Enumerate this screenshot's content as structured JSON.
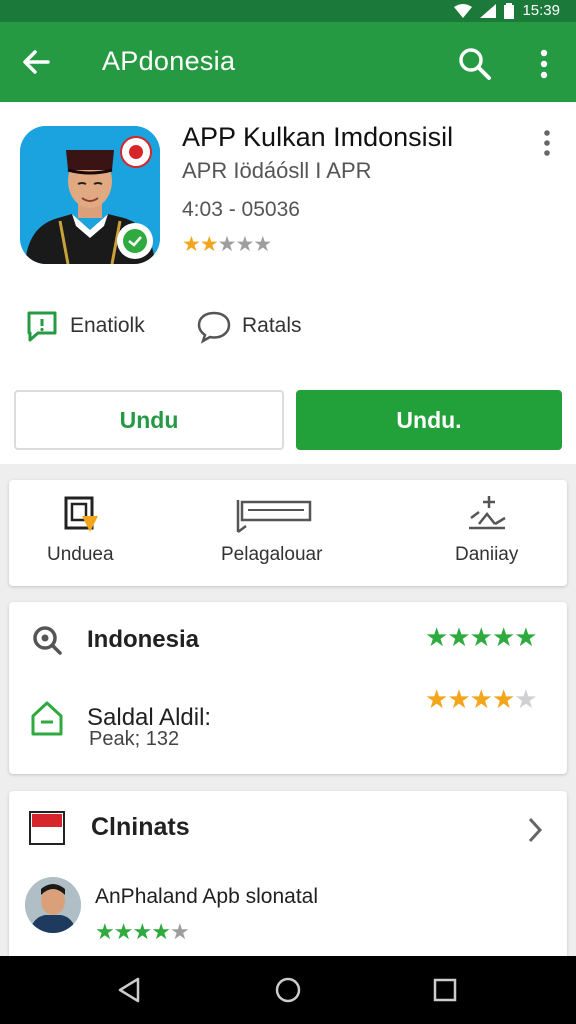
{
  "status_bar": {
    "time": "15:39"
  },
  "app_bar": {
    "title": "APdonesia"
  },
  "app": {
    "name": "APP Kulkan Imdonsisil",
    "developer": "APR Iödáósll I APR",
    "version": "4:03 - 05036",
    "rating": {
      "value": 2,
      "of": 5
    }
  },
  "meta": [
    {
      "icon": "feedback-icon",
      "label": "Enatiolk"
    },
    {
      "icon": "chat-bubble-icon",
      "label": "Ratals"
    }
  ],
  "buttons": {
    "secondary": "Undu",
    "primary": "Undu."
  },
  "actions": [
    {
      "icon": "install-icon",
      "label": "Unduea"
    },
    {
      "icon": "ticket-icon",
      "label": "Pelagalouar"
    },
    {
      "icon": "sparkle-icon",
      "label": "Daniiay"
    }
  ],
  "ratings_card": {
    "rows": [
      {
        "icon": "search-icon",
        "title": "Indonesia",
        "subtitle": "",
        "stars": 5
      },
      {
        "icon": "home-icon",
        "title": "Saldal Aldil:",
        "subtitle": "Peak; 132",
        "stars": 4
      }
    ]
  },
  "similar_card": {
    "title": "Clninats",
    "item": {
      "name": "AnPhaland Apb slonatal",
      "stars": 4
    }
  },
  "colors": {
    "primary": "#259a43",
    "status_bar": "#1b7a3a",
    "star_green": "#2eaa3f",
    "star_orange": "#f3a51c"
  }
}
